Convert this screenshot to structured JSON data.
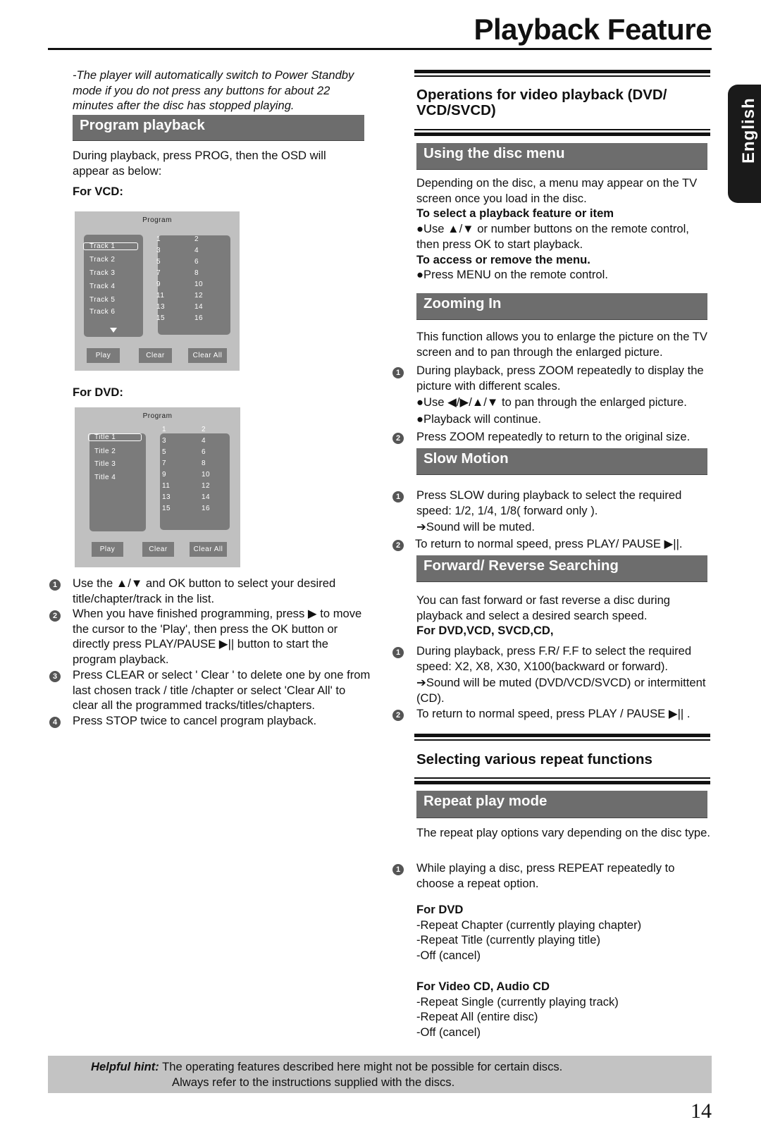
{
  "header": {
    "title": "Playback Feature",
    "language_tab": "English"
  },
  "left": {
    "note": "-The player will automatically switch to Power Standby mode if you do not press any buttons for about 22 minutes after the disc has stopped playing.",
    "program_heading": "Program playback",
    "intro": "During playback, press  PROG, then the OSD will appear as below:",
    "for_vcd": "For VCD:",
    "for_dvd": "For DVD:",
    "vcd_osd": {
      "title": "Program",
      "items": [
        "Track 1",
        "Track 2",
        "Track 3",
        "Track 4",
        "Track 5",
        "Track 6"
      ],
      "numbers": [
        "1",
        "2",
        "3",
        "4",
        "5",
        "6",
        "7",
        "8",
        "9",
        "10",
        "11",
        "12",
        "13",
        "14",
        "15",
        "16"
      ],
      "buttons": [
        "Play",
        "Clear",
        "Clear All"
      ]
    },
    "dvd_osd": {
      "title": "Program",
      "items": [
        "Title 1",
        "Title 2",
        "Title 3",
        "Title 4"
      ],
      "numbers": [
        "1",
        "2",
        "3",
        "4",
        "5",
        "6",
        "7",
        "8",
        "9",
        "10",
        "11",
        "12",
        "13",
        "14",
        "15",
        "16"
      ],
      "buttons": [
        "Play",
        "Clear",
        "Clear All"
      ]
    },
    "steps": [
      "Use the ▲/▼ and OK button to select your desired title/chapter/track in the list.",
      "When you have finished programming, press ▶ to move the cursor to the 'Play', then press the OK button or directly press PLAY/PAUSE ▶|| button to start the program playback.",
      "Press CLEAR or select ' Clear ' to delete one by one from last chosen track / title /chapter or select 'Clear All' to clear all the programmed tracks/titles/chapters.",
      "Press STOP twice to cancel program playback."
    ]
  },
  "right": {
    "ops_heading": "Operations for video playback (DVD/ VCD/SVCD)",
    "disc_menu": {
      "heading": "Using the disc menu",
      "p1": "Depending on the disc, a menu may appear on the TV screen once you load in the disc.",
      "sub1": "To select a playback feature or item",
      "b1": "●Use ▲/▼ or number buttons on the remote control, then press OK to start playback.",
      "sub2": "To access or remove the menu.",
      "b2": "●Press MENU on the remote control."
    },
    "zoom": {
      "heading": "Zooming In",
      "p1": "This function allows you to enlarge the picture on the TV screen and to pan through the enlarged picture.",
      "s1": "During playback, press ZOOM repeatedly to display the picture with different scales.",
      "b1": "●Use ◀/▶/▲/▼ to pan through the enlarged picture.",
      "b2": "●Playback will continue.",
      "s2": "Press ZOOM repeatedly to return to the original size."
    },
    "slow": {
      "heading": "Slow Motion",
      "s1": "Press SLOW during playback to select the required speed: 1/2, 1/4, 1/8( forward only ).",
      "b1": "➔Sound will be muted.",
      "s2": "To return to normal speed, press PLAY/ PAUSE ▶||."
    },
    "search": {
      "heading": "Forward/ Reverse Searching",
      "p1": "You can fast forward or fast reverse a disc during playback and select a desired search speed.",
      "sub": "For  DVD,VCD, SVCD,CD,",
      "s1": "During playback, press F.R/ F.F to select the required speed: X2, X8, X30, X100(backward or forward).",
      "b1": "➔Sound will be muted (DVD/VCD/SVCD) or intermittent (CD).",
      "s2": "To return to normal speed, press PLAY / PAUSE ▶|| ."
    },
    "repeat_heading": "Selecting various repeat functions",
    "repeat": {
      "heading": "Repeat play mode",
      "p1": "The repeat play options vary depending on the disc type.",
      "s1": "While playing a disc, press REPEAT repeatedly to choose a repeat option.",
      "dvd_label": "For DVD",
      "dvd_options": [
        "-Repeat Chapter (currently playing chapter)",
        "-Repeat Title (currently playing title)",
        "-Off (cancel)"
      ],
      "vcd_label": "For Video CD, Audio CD",
      "vcd_options": [
        "-Repeat Single (currently playing track)",
        "-Repeat All (entire disc)",
        "-Off (cancel)"
      ]
    }
  },
  "hint": {
    "label": "Helpful hint:",
    "line1": "The operating features described here might not be possible for certain discs.",
    "line2": "Always refer to the instructions  supplied with the discs."
  },
  "page_number": "14"
}
